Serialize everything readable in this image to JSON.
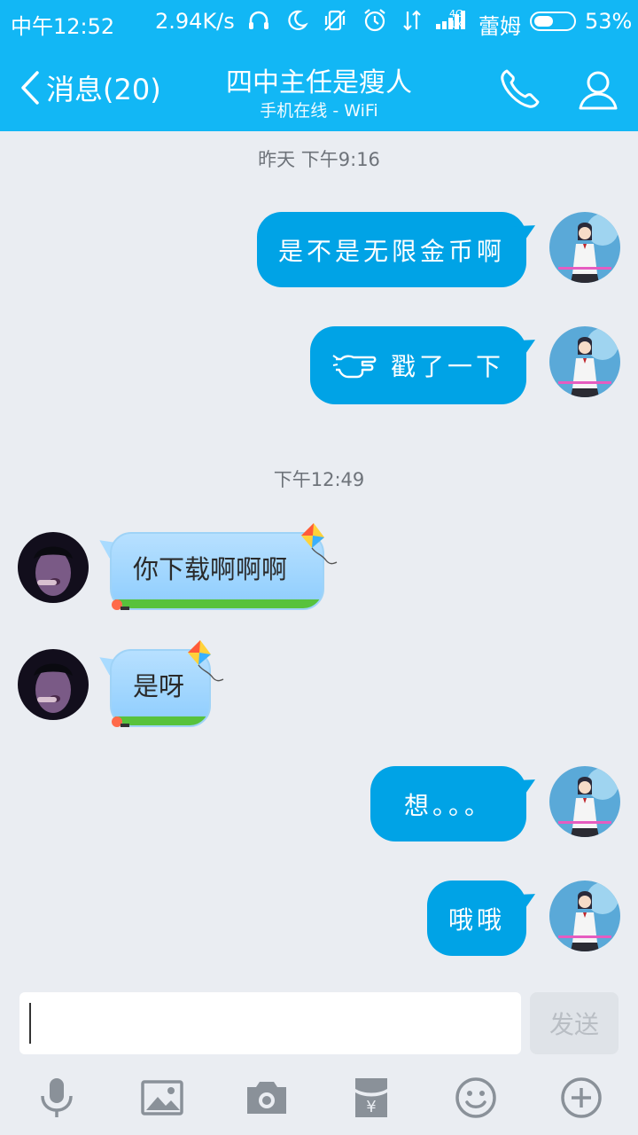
{
  "status_bar": {
    "time": "中午12:52",
    "speed": "2.94K/s",
    "network_top": "4G",
    "network_bottom": "1X",
    "carrier": "蕾姆",
    "battery": "53%",
    "battery_level": 0.53
  },
  "nav": {
    "back_label": "消息(20)",
    "title": "四中主任是瘦人",
    "subtitle": "手机在线 - WiFi"
  },
  "messages": [
    {
      "type": "timestamp",
      "text": "昨天 下午9:16"
    },
    {
      "type": "outgoing",
      "text": "是不是无限金币啊"
    },
    {
      "type": "outgoing",
      "text": "戳了一下",
      "icon": "poke-hand-icon"
    },
    {
      "type": "timestamp",
      "text": "下午12:49"
    },
    {
      "type": "incoming",
      "text": "你下载啊啊啊"
    },
    {
      "type": "incoming",
      "text": "是呀"
    },
    {
      "type": "outgoing",
      "text": "想。。。"
    },
    {
      "type": "outgoing",
      "text": "哦哦"
    }
  ],
  "composer": {
    "input_value": "",
    "send_label": "发送"
  },
  "toolbar": [
    "mic-icon",
    "image-icon",
    "camera-icon",
    "red-packet-icon",
    "emoji-icon",
    "plus-icon"
  ],
  "colors": {
    "header": "#12b7f5",
    "outgoing_bubble": "#00a3e6",
    "background": "#eaedf2"
  }
}
